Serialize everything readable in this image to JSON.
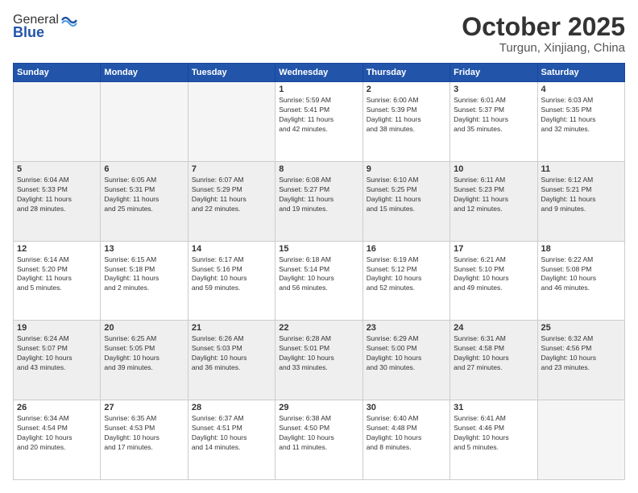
{
  "header": {
    "logo_general": "General",
    "logo_blue": "Blue",
    "month": "October 2025",
    "location": "Turgun, Xinjiang, China"
  },
  "weekdays": [
    "Sunday",
    "Monday",
    "Tuesday",
    "Wednesday",
    "Thursday",
    "Friday",
    "Saturday"
  ],
  "weeks": [
    [
      {
        "day": "",
        "info": ""
      },
      {
        "day": "",
        "info": ""
      },
      {
        "day": "",
        "info": ""
      },
      {
        "day": "1",
        "info": "Sunrise: 5:59 AM\nSunset: 5:41 PM\nDaylight: 11 hours\nand 42 minutes."
      },
      {
        "day": "2",
        "info": "Sunrise: 6:00 AM\nSunset: 5:39 PM\nDaylight: 11 hours\nand 38 minutes."
      },
      {
        "day": "3",
        "info": "Sunrise: 6:01 AM\nSunset: 5:37 PM\nDaylight: 11 hours\nand 35 minutes."
      },
      {
        "day": "4",
        "info": "Sunrise: 6:03 AM\nSunset: 5:35 PM\nDaylight: 11 hours\nand 32 minutes."
      }
    ],
    [
      {
        "day": "5",
        "info": "Sunrise: 6:04 AM\nSunset: 5:33 PM\nDaylight: 11 hours\nand 28 minutes."
      },
      {
        "day": "6",
        "info": "Sunrise: 6:05 AM\nSunset: 5:31 PM\nDaylight: 11 hours\nand 25 minutes."
      },
      {
        "day": "7",
        "info": "Sunrise: 6:07 AM\nSunset: 5:29 PM\nDaylight: 11 hours\nand 22 minutes."
      },
      {
        "day": "8",
        "info": "Sunrise: 6:08 AM\nSunset: 5:27 PM\nDaylight: 11 hours\nand 19 minutes."
      },
      {
        "day": "9",
        "info": "Sunrise: 6:10 AM\nSunset: 5:25 PM\nDaylight: 11 hours\nand 15 minutes."
      },
      {
        "day": "10",
        "info": "Sunrise: 6:11 AM\nSunset: 5:23 PM\nDaylight: 11 hours\nand 12 minutes."
      },
      {
        "day": "11",
        "info": "Sunrise: 6:12 AM\nSunset: 5:21 PM\nDaylight: 11 hours\nand 9 minutes."
      }
    ],
    [
      {
        "day": "12",
        "info": "Sunrise: 6:14 AM\nSunset: 5:20 PM\nDaylight: 11 hours\nand 5 minutes."
      },
      {
        "day": "13",
        "info": "Sunrise: 6:15 AM\nSunset: 5:18 PM\nDaylight: 11 hours\nand 2 minutes."
      },
      {
        "day": "14",
        "info": "Sunrise: 6:17 AM\nSunset: 5:16 PM\nDaylight: 10 hours\nand 59 minutes."
      },
      {
        "day": "15",
        "info": "Sunrise: 6:18 AM\nSunset: 5:14 PM\nDaylight: 10 hours\nand 56 minutes."
      },
      {
        "day": "16",
        "info": "Sunrise: 6:19 AM\nSunset: 5:12 PM\nDaylight: 10 hours\nand 52 minutes."
      },
      {
        "day": "17",
        "info": "Sunrise: 6:21 AM\nSunset: 5:10 PM\nDaylight: 10 hours\nand 49 minutes."
      },
      {
        "day": "18",
        "info": "Sunrise: 6:22 AM\nSunset: 5:08 PM\nDaylight: 10 hours\nand 46 minutes."
      }
    ],
    [
      {
        "day": "19",
        "info": "Sunrise: 6:24 AM\nSunset: 5:07 PM\nDaylight: 10 hours\nand 43 minutes."
      },
      {
        "day": "20",
        "info": "Sunrise: 6:25 AM\nSunset: 5:05 PM\nDaylight: 10 hours\nand 39 minutes."
      },
      {
        "day": "21",
        "info": "Sunrise: 6:26 AM\nSunset: 5:03 PM\nDaylight: 10 hours\nand 36 minutes."
      },
      {
        "day": "22",
        "info": "Sunrise: 6:28 AM\nSunset: 5:01 PM\nDaylight: 10 hours\nand 33 minutes."
      },
      {
        "day": "23",
        "info": "Sunrise: 6:29 AM\nSunset: 5:00 PM\nDaylight: 10 hours\nand 30 minutes."
      },
      {
        "day": "24",
        "info": "Sunrise: 6:31 AM\nSunset: 4:58 PM\nDaylight: 10 hours\nand 27 minutes."
      },
      {
        "day": "25",
        "info": "Sunrise: 6:32 AM\nSunset: 4:56 PM\nDaylight: 10 hours\nand 23 minutes."
      }
    ],
    [
      {
        "day": "26",
        "info": "Sunrise: 6:34 AM\nSunset: 4:54 PM\nDaylight: 10 hours\nand 20 minutes."
      },
      {
        "day": "27",
        "info": "Sunrise: 6:35 AM\nSunset: 4:53 PM\nDaylight: 10 hours\nand 17 minutes."
      },
      {
        "day": "28",
        "info": "Sunrise: 6:37 AM\nSunset: 4:51 PM\nDaylight: 10 hours\nand 14 minutes."
      },
      {
        "day": "29",
        "info": "Sunrise: 6:38 AM\nSunset: 4:50 PM\nDaylight: 10 hours\nand 11 minutes."
      },
      {
        "day": "30",
        "info": "Sunrise: 6:40 AM\nSunset: 4:48 PM\nDaylight: 10 hours\nand 8 minutes."
      },
      {
        "day": "31",
        "info": "Sunrise: 6:41 AM\nSunset: 4:46 PM\nDaylight: 10 hours\nand 5 minutes."
      },
      {
        "day": "",
        "info": ""
      }
    ]
  ]
}
